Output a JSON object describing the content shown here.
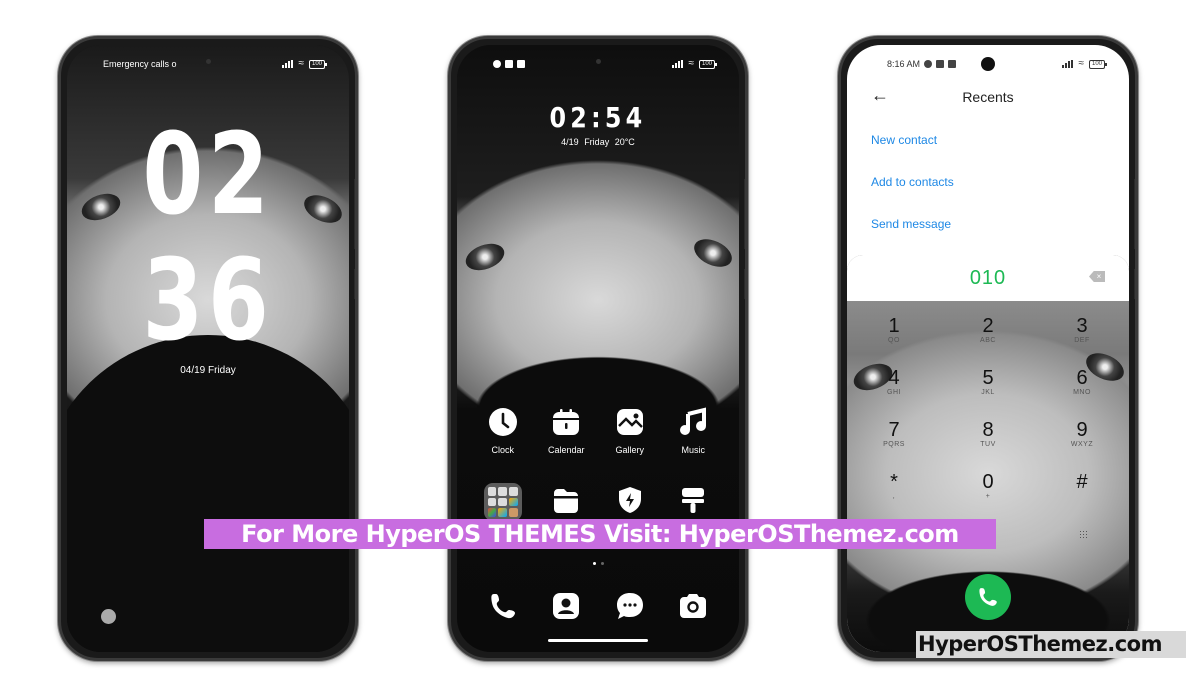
{
  "phones": {
    "lockscreen": {
      "status_left": "Emergency calls o",
      "battery": "100",
      "clock_hours": "02",
      "clock_minutes": "36",
      "date": "04/19 Friday"
    },
    "homescreen": {
      "battery": "100",
      "clock": "02:54",
      "date": "4/19 Friday 20°C",
      "apps_row1": [
        {
          "label": "Clock",
          "icon": "clock-icon"
        },
        {
          "label": "Calendar",
          "icon": "calendar-icon"
        },
        {
          "label": "Gallery",
          "icon": "gallery-icon"
        },
        {
          "label": "Music",
          "icon": "music-icon"
        }
      ],
      "apps_row2": [
        {
          "label": "",
          "icon": "folder-icon"
        },
        {
          "label": "",
          "icon": "file-manager-icon"
        },
        {
          "label": "",
          "icon": "security-icon"
        },
        {
          "label": "",
          "icon": "themes-icon"
        }
      ],
      "dock": [
        {
          "icon": "phone-icon"
        },
        {
          "icon": "contacts-icon"
        },
        {
          "icon": "messages-icon"
        },
        {
          "icon": "camera-icon"
        }
      ],
      "page_count": 2,
      "active_page": 1
    },
    "dialer": {
      "status_time": "8:16 AM",
      "battery": "100",
      "title": "Recents",
      "actions": [
        "New contact",
        "Add to contacts",
        "Send message"
      ],
      "number": "010",
      "keys": [
        {
          "digit": "1",
          "letters": "QO"
        },
        {
          "digit": "2",
          "letters": "ABC"
        },
        {
          "digit": "3",
          "letters": "DEF"
        },
        {
          "digit": "4",
          "letters": "GHI"
        },
        {
          "digit": "5",
          "letters": "JKL"
        },
        {
          "digit": "6",
          "letters": "MNO"
        },
        {
          "digit": "7",
          "letters": "PQRS"
        },
        {
          "digit": "8",
          "letters": "TUV"
        },
        {
          "digit": "9",
          "letters": "WXYZ"
        },
        {
          "digit": "*",
          "letters": ","
        },
        {
          "digit": "0",
          "letters": "+"
        },
        {
          "digit": "#",
          "letters": ""
        }
      ],
      "accent_color": "#1db954",
      "link_color": "#1e88e5"
    }
  },
  "promo_banner": "For More HyperOS THEMES Visit: HyperOSThemez.com",
  "watermark": "HyperOSThemez.com",
  "colors": {
    "promo_bg": "#c86de0",
    "watermark_bg": "#d9d9d9"
  }
}
